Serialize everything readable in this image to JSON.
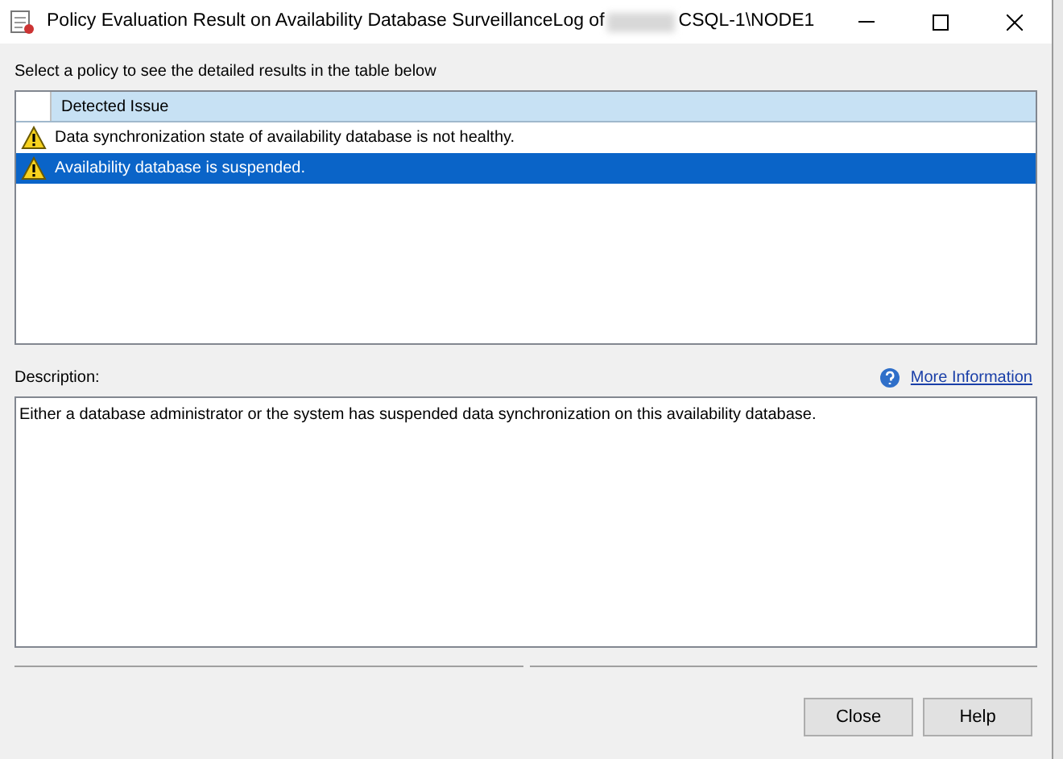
{
  "window": {
    "title": "Policy Evaluation Result on Availability Database SurveillanceLog of",
    "title_suffix": "CSQL-1\\NODE1"
  },
  "instruction": "Select a policy to see the detailed results in the table below",
  "table": {
    "columns": [
      "Detected Issue"
    ],
    "rows": [
      {
        "issue": "Data synchronization state of availability database is not healthy.",
        "selected": false
      },
      {
        "issue": "Availability database is suspended.",
        "selected": true
      }
    ]
  },
  "description": {
    "label": "Description:",
    "link": "More Information",
    "text": "Either a database administrator or the system has suspended data synchronization on this availability database."
  },
  "buttons": [
    "Close",
    "Help"
  ]
}
